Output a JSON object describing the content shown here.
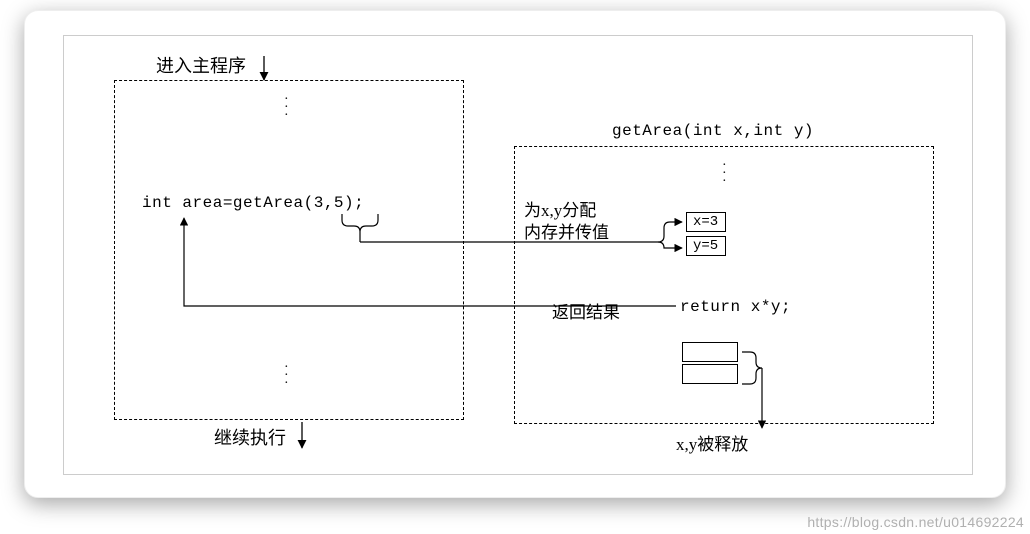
{
  "main": {
    "enter_label": "进入主程序",
    "call_code": "int area=getArea(3,5);",
    "continue_label": "继续执行"
  },
  "callee": {
    "signature": "getArea(int x,int y)",
    "alloc_label_line1": "为x,y分配",
    "alloc_label_line2": "内存并传值",
    "val_x": "x=3",
    "val_y": "y=5",
    "return_code": "return x*y;",
    "return_label": "返回结果",
    "release_label": "x,y被释放"
  },
  "watermark": "https://blog.csdn.net/u014692224"
}
